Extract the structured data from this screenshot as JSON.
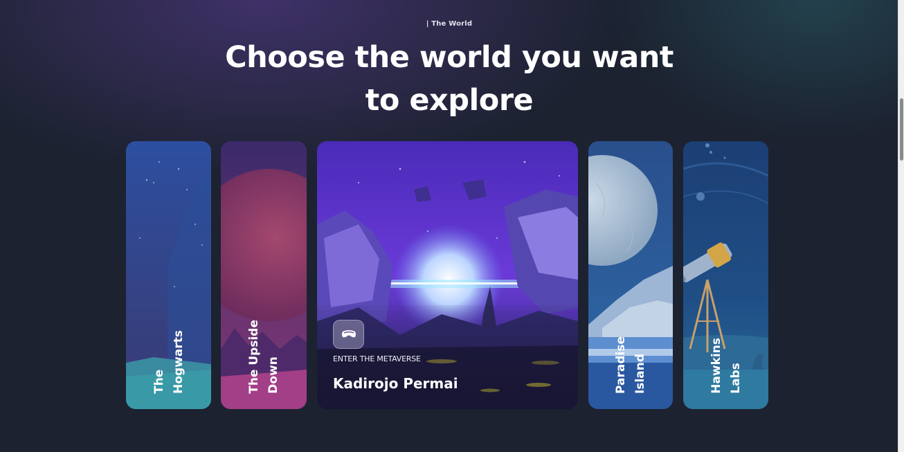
{
  "section": {
    "eyebrow": "| The World",
    "heading_line1": "Choose the world you want",
    "heading_line2": "to explore"
  },
  "cards": [
    {
      "line1": "The",
      "line2": "Hogwarts"
    },
    {
      "line1": "The Upside",
      "line2": "Down"
    },
    {
      "tag": "ENTER THE METAVERSE",
      "title": "Kadirojo Permai",
      "icon": "vr-headset-icon"
    },
    {
      "line1": "Paradise",
      "line2": "Island"
    },
    {
      "line1": "Hawkins",
      "line2": "Labs"
    }
  ],
  "colors": {
    "background": "#1c2230",
    "accent_purple": "#6a2fd0",
    "card_blue": "#2b5a9e"
  }
}
